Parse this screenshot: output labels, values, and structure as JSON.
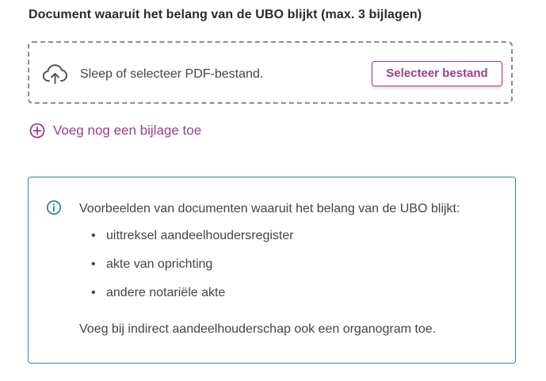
{
  "upload": {
    "label": "Document waaruit het belang van de UBO blijkt (max. 3 bijlagen)",
    "dropzone_text": "Sleep of selecteer PDF-bestand.",
    "select_button_label": "Selecteer bestand",
    "cloud_icon": "cloud-upload-icon"
  },
  "add_attachment": {
    "label": "Voeg nog een bijlage toe",
    "icon": "plus-circle-icon"
  },
  "info": {
    "icon": "info-icon",
    "intro": "Voorbeelden van documenten waaruit het belang van de UBO blijkt:",
    "items": [
      {
        "bullet": "•",
        "label": "uittreksel aandeelhoudersregister"
      },
      {
        "bullet": "•",
        "label": "akte van oprichting"
      },
      {
        "bullet": "•",
        "label": "andere notariële akte"
      }
    ],
    "footer": "Voeg bij indirect aandeelhouderschap ook een organogram toe."
  },
  "colors": {
    "accent": "#9a3f87",
    "info_border": "#2e86b3",
    "text": "#444444",
    "dashed_border": "#8c8c8c"
  }
}
